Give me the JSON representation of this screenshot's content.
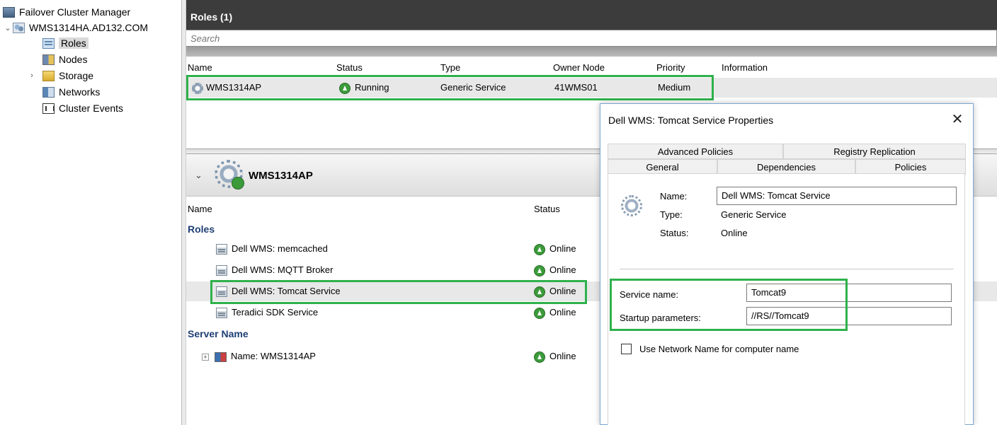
{
  "tree": {
    "root": "Failover Cluster Manager",
    "cluster": "WMS1314HA.AD132.COM",
    "items": [
      {
        "label": "Roles",
        "icon": "roles-icon",
        "selected": true
      },
      {
        "label": "Nodes",
        "icon": "nodes-icon"
      },
      {
        "label": "Storage",
        "icon": "storage-icon",
        "expandable": true
      },
      {
        "label": "Networks",
        "icon": "networks-icon"
      },
      {
        "label": "Cluster Events",
        "icon": "cluster-events-icon"
      }
    ]
  },
  "roles": {
    "header": "Roles (1)",
    "search_placeholder": "Search",
    "columns": [
      "Name",
      "Status",
      "Type",
      "Owner Node",
      "Priority",
      "Information"
    ],
    "row": {
      "name": "WMS1314AP",
      "status": "Running",
      "type": "Generic Service",
      "owner_node": "41WMS01",
      "priority": "Medium",
      "information": ""
    }
  },
  "details": {
    "title": "WMS1314AP",
    "columns": [
      "Name",
      "Status"
    ],
    "roles_group": "Roles",
    "roles": [
      {
        "name": "Dell WMS: memcached",
        "status": "Online"
      },
      {
        "name": "Dell WMS: MQTT Broker",
        "status": "Online"
      },
      {
        "name": "Dell WMS: Tomcat Service",
        "status": "Online"
      },
      {
        "name": "Teradici SDK Service",
        "status": "Online"
      }
    ],
    "server_group": "Server Name",
    "server": {
      "name": "Name: WMS1314AP",
      "status": "Online"
    }
  },
  "dialog": {
    "title": "Dell WMS: Tomcat Service Properties",
    "close": "✕",
    "tabs_back": [
      "Advanced Policies",
      "Registry Replication"
    ],
    "tabs_front": [
      "General",
      "Dependencies",
      "Policies"
    ],
    "active_tab": "General",
    "name_label": "Name:",
    "name_value": "Dell WMS: Tomcat Service",
    "type_label": "Type:",
    "type_value": "Generic Service",
    "status_label": "Status:",
    "status_value": "Online",
    "service_name_label": "Service name:",
    "service_name_value": "Tomcat9",
    "startup_label": "Startup parameters:",
    "startup_value": "//RS//Tomcat9",
    "checkbox_label": "Use Network Name for computer name",
    "checkbox_checked": false
  },
  "colors": {
    "highlight": "#2fb14c",
    "header_bg": "#3c3c3c"
  }
}
